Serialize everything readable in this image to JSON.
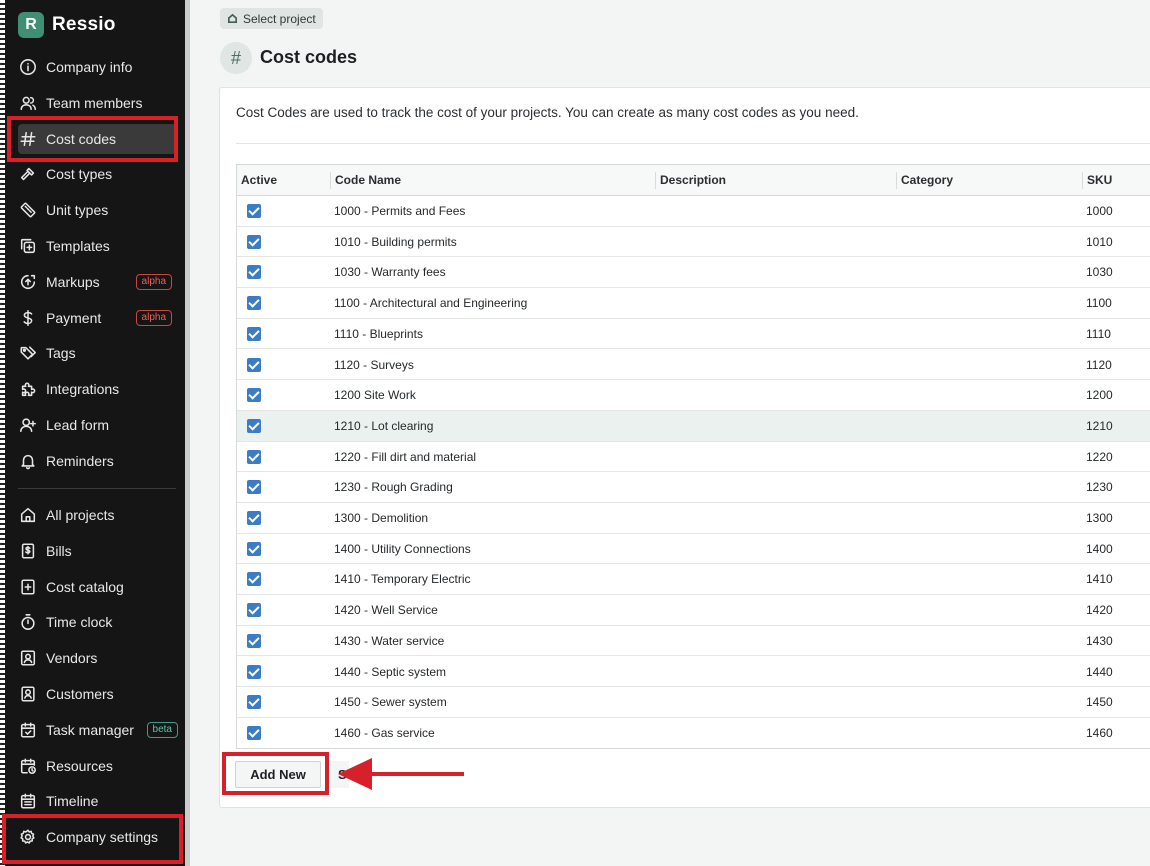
{
  "brand": {
    "name": "Ressio",
    "logo_letter": "R"
  },
  "sidebar": {
    "settings_items": [
      {
        "label": "Company info",
        "icon": "info-icon"
      },
      {
        "label": "Team members",
        "icon": "users-icon"
      },
      {
        "label": "Cost codes",
        "icon": "hash-icon",
        "active": true
      },
      {
        "label": "Cost types",
        "icon": "hammer-icon"
      },
      {
        "label": "Unit types",
        "icon": "ruler-icon"
      },
      {
        "label": "Templates",
        "icon": "copy-plus-icon"
      },
      {
        "label": "Markups",
        "icon": "markup-icon",
        "badge": "alpha"
      },
      {
        "label": "Payment",
        "icon": "dollar-icon",
        "badge": "alpha"
      },
      {
        "label": "Tags",
        "icon": "tags-icon"
      },
      {
        "label": "Integrations",
        "icon": "puzzle-icon"
      },
      {
        "label": "Lead form",
        "icon": "user-plus-icon"
      },
      {
        "label": "Reminders",
        "icon": "bell-icon"
      }
    ],
    "app_items": [
      {
        "label": "All projects",
        "icon": "home-icon"
      },
      {
        "label": "Bills",
        "icon": "bill-icon"
      },
      {
        "label": "Cost catalog",
        "icon": "catalog-icon"
      },
      {
        "label": "Time clock",
        "icon": "stopwatch-icon"
      },
      {
        "label": "Vendors",
        "icon": "vendor-icon"
      },
      {
        "label": "Customers",
        "icon": "customer-icon"
      },
      {
        "label": "Task manager",
        "icon": "calendar-check-icon",
        "badge": "beta"
      },
      {
        "label": "Resources",
        "icon": "calendar-clock-icon"
      },
      {
        "label": "Timeline",
        "icon": "calendar-icon"
      },
      {
        "label": "Company settings",
        "icon": "gear-icon"
      }
    ]
  },
  "breadcrumb": {
    "label": "Select project"
  },
  "page": {
    "title": "Cost codes",
    "description": "Cost Codes are used to track the cost of your projects. You can create as many cost codes as you need."
  },
  "table": {
    "columns": [
      "Active",
      "Code Name",
      "Description",
      "Category",
      "SKU"
    ],
    "rows": [
      {
        "active": true,
        "name": "1000 - Permits and Fees",
        "description": "",
        "category": "",
        "sku": "1000"
      },
      {
        "active": true,
        "name": "1010 - Building permits",
        "description": "",
        "category": "",
        "sku": "1010"
      },
      {
        "active": true,
        "name": "1030 - Warranty fees",
        "description": "",
        "category": "",
        "sku": "1030"
      },
      {
        "active": true,
        "name": "1100 - Architectural and Engineering",
        "description": "",
        "category": "",
        "sku": "1100"
      },
      {
        "active": true,
        "name": "1110 - Blueprints",
        "description": "",
        "category": "",
        "sku": "1110"
      },
      {
        "active": true,
        "name": "1120 - Surveys",
        "description": "",
        "category": "",
        "sku": "1120"
      },
      {
        "active": true,
        "name": "1200 Site Work",
        "description": "",
        "category": "",
        "sku": "1200"
      },
      {
        "active": true,
        "name": "1210 - Lot clearing",
        "description": "",
        "category": "",
        "sku": "1210",
        "highlighted": true
      },
      {
        "active": true,
        "name": "1220 - Fill dirt and material",
        "description": "",
        "category": "",
        "sku": "1220"
      },
      {
        "active": true,
        "name": "1230 - Rough Grading",
        "description": "",
        "category": "",
        "sku": "1230"
      },
      {
        "active": true,
        "name": "1300 - Demolition",
        "description": "",
        "category": "",
        "sku": "1300"
      },
      {
        "active": true,
        "name": "1400 - Utility Connections",
        "description": "",
        "category": "",
        "sku": "1400"
      },
      {
        "active": true,
        "name": "1410 - Temporary Electric",
        "description": "",
        "category": "",
        "sku": "1410"
      },
      {
        "active": true,
        "name": "1420 - Well Service",
        "description": "",
        "category": "",
        "sku": "1420"
      },
      {
        "active": true,
        "name": "1430 - Water service",
        "description": "",
        "category": "",
        "sku": "1430"
      },
      {
        "active": true,
        "name": "1440 - Septic system",
        "description": "",
        "category": "",
        "sku": "1440"
      },
      {
        "active": true,
        "name": "1450 - Sewer system",
        "description": "",
        "category": "",
        "sku": "1450"
      },
      {
        "active": true,
        "name": "1460 - Gas service",
        "description": "",
        "category": "",
        "sku": "1460"
      }
    ]
  },
  "actions": {
    "add_new": "Add New",
    "second_button": "S"
  },
  "colors": {
    "accent": "#3f8f74",
    "highlight_box": "#d6212a",
    "checkbox": "#3b7cc7",
    "sidebar_bg": "#151515"
  }
}
